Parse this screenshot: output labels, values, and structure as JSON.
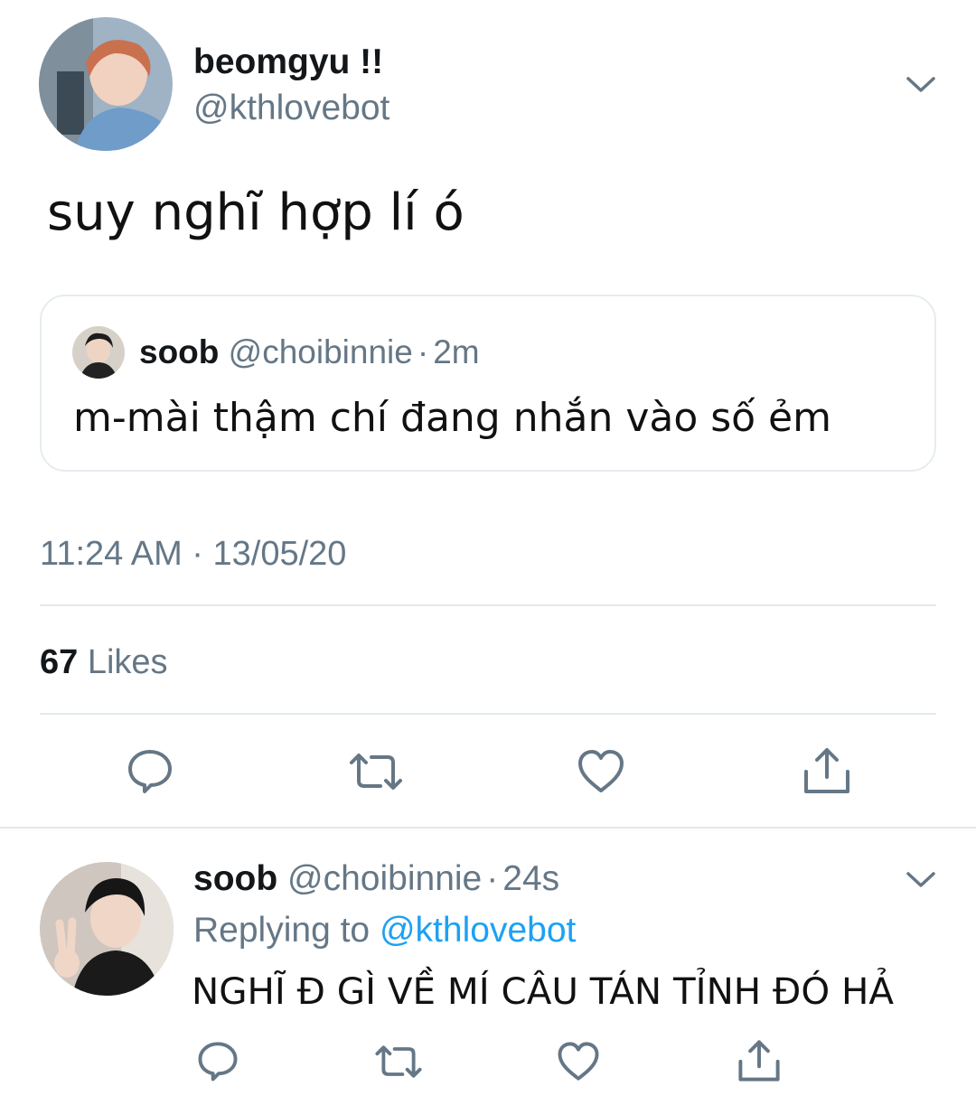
{
  "tweet": {
    "author": {
      "display_name": "beomgyu !!",
      "handle": "@kthlovebot"
    },
    "text": "suy nghĩ hợp lí ó",
    "quoted": {
      "display_name": "soob",
      "handle": "@choibinnie",
      "separator": "·",
      "time": "2m",
      "text": "m-mài thậm chí đang nhắn vào số ẻm"
    },
    "timestamp": "11:24 AM · 13/05/20",
    "likes": {
      "count": "67",
      "label": "Likes"
    },
    "actions": [
      "reply-icon",
      "retweet-icon",
      "like-icon",
      "share-icon"
    ]
  },
  "reply": {
    "author": {
      "display_name": "soob",
      "handle": "@choibinnie",
      "separator": "·",
      "time": "24s"
    },
    "replying_to_label": "Replying to",
    "replying_to_handle": "@kthlovebot",
    "text": "NGHĨ Đ GÌ VỀ MÍ CÂU TÁN TỈNH ĐÓ HẢ",
    "actions": [
      "reply-icon",
      "retweet-icon",
      "like-icon",
      "share-icon"
    ]
  },
  "colors": {
    "text": "#14171a",
    "muted": "#657786",
    "link": "#1da1f2",
    "border": "#e1e8ed"
  }
}
